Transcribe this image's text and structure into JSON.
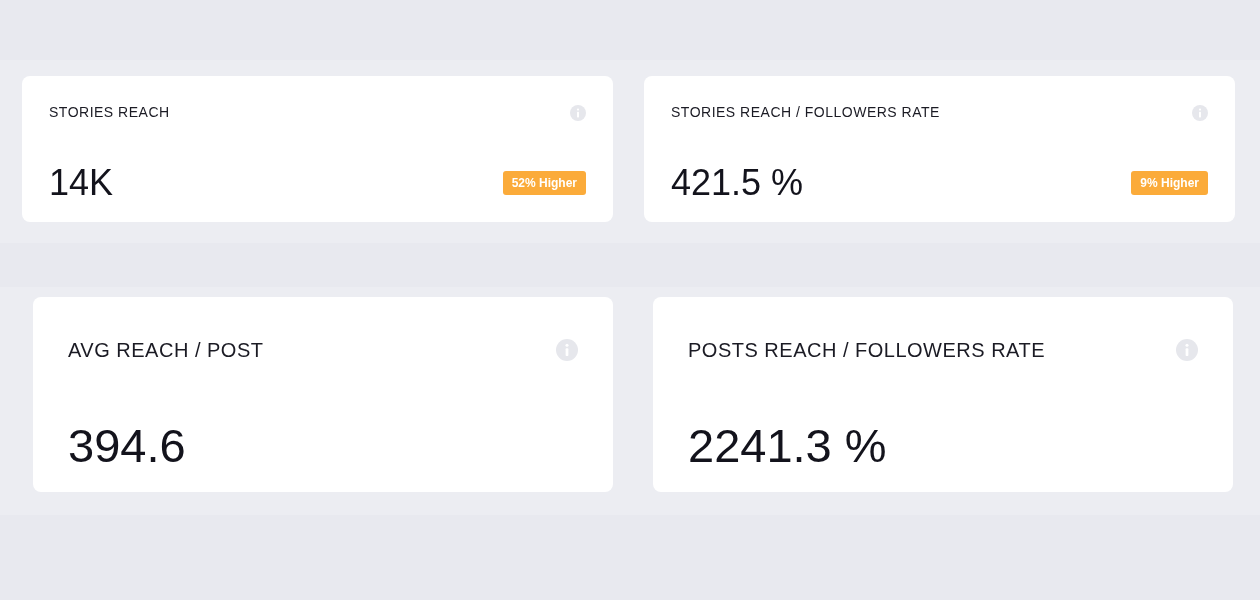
{
  "sections": [
    {
      "kind": "compact",
      "cards": [
        {
          "title": "STORIES REACH",
          "value": "14K",
          "badge": "52% Higher"
        },
        {
          "title": "STORIES REACH / FOLLOWERS RATE",
          "value": "421.5 %",
          "badge": "9% Higher"
        }
      ]
    },
    {
      "kind": "large",
      "cards": [
        {
          "title": "AVG REACH / POST",
          "value": "394.6"
        },
        {
          "title": "POSTS REACH / FOLLOWERS RATE",
          "value": "2241.3 %"
        }
      ]
    }
  ]
}
